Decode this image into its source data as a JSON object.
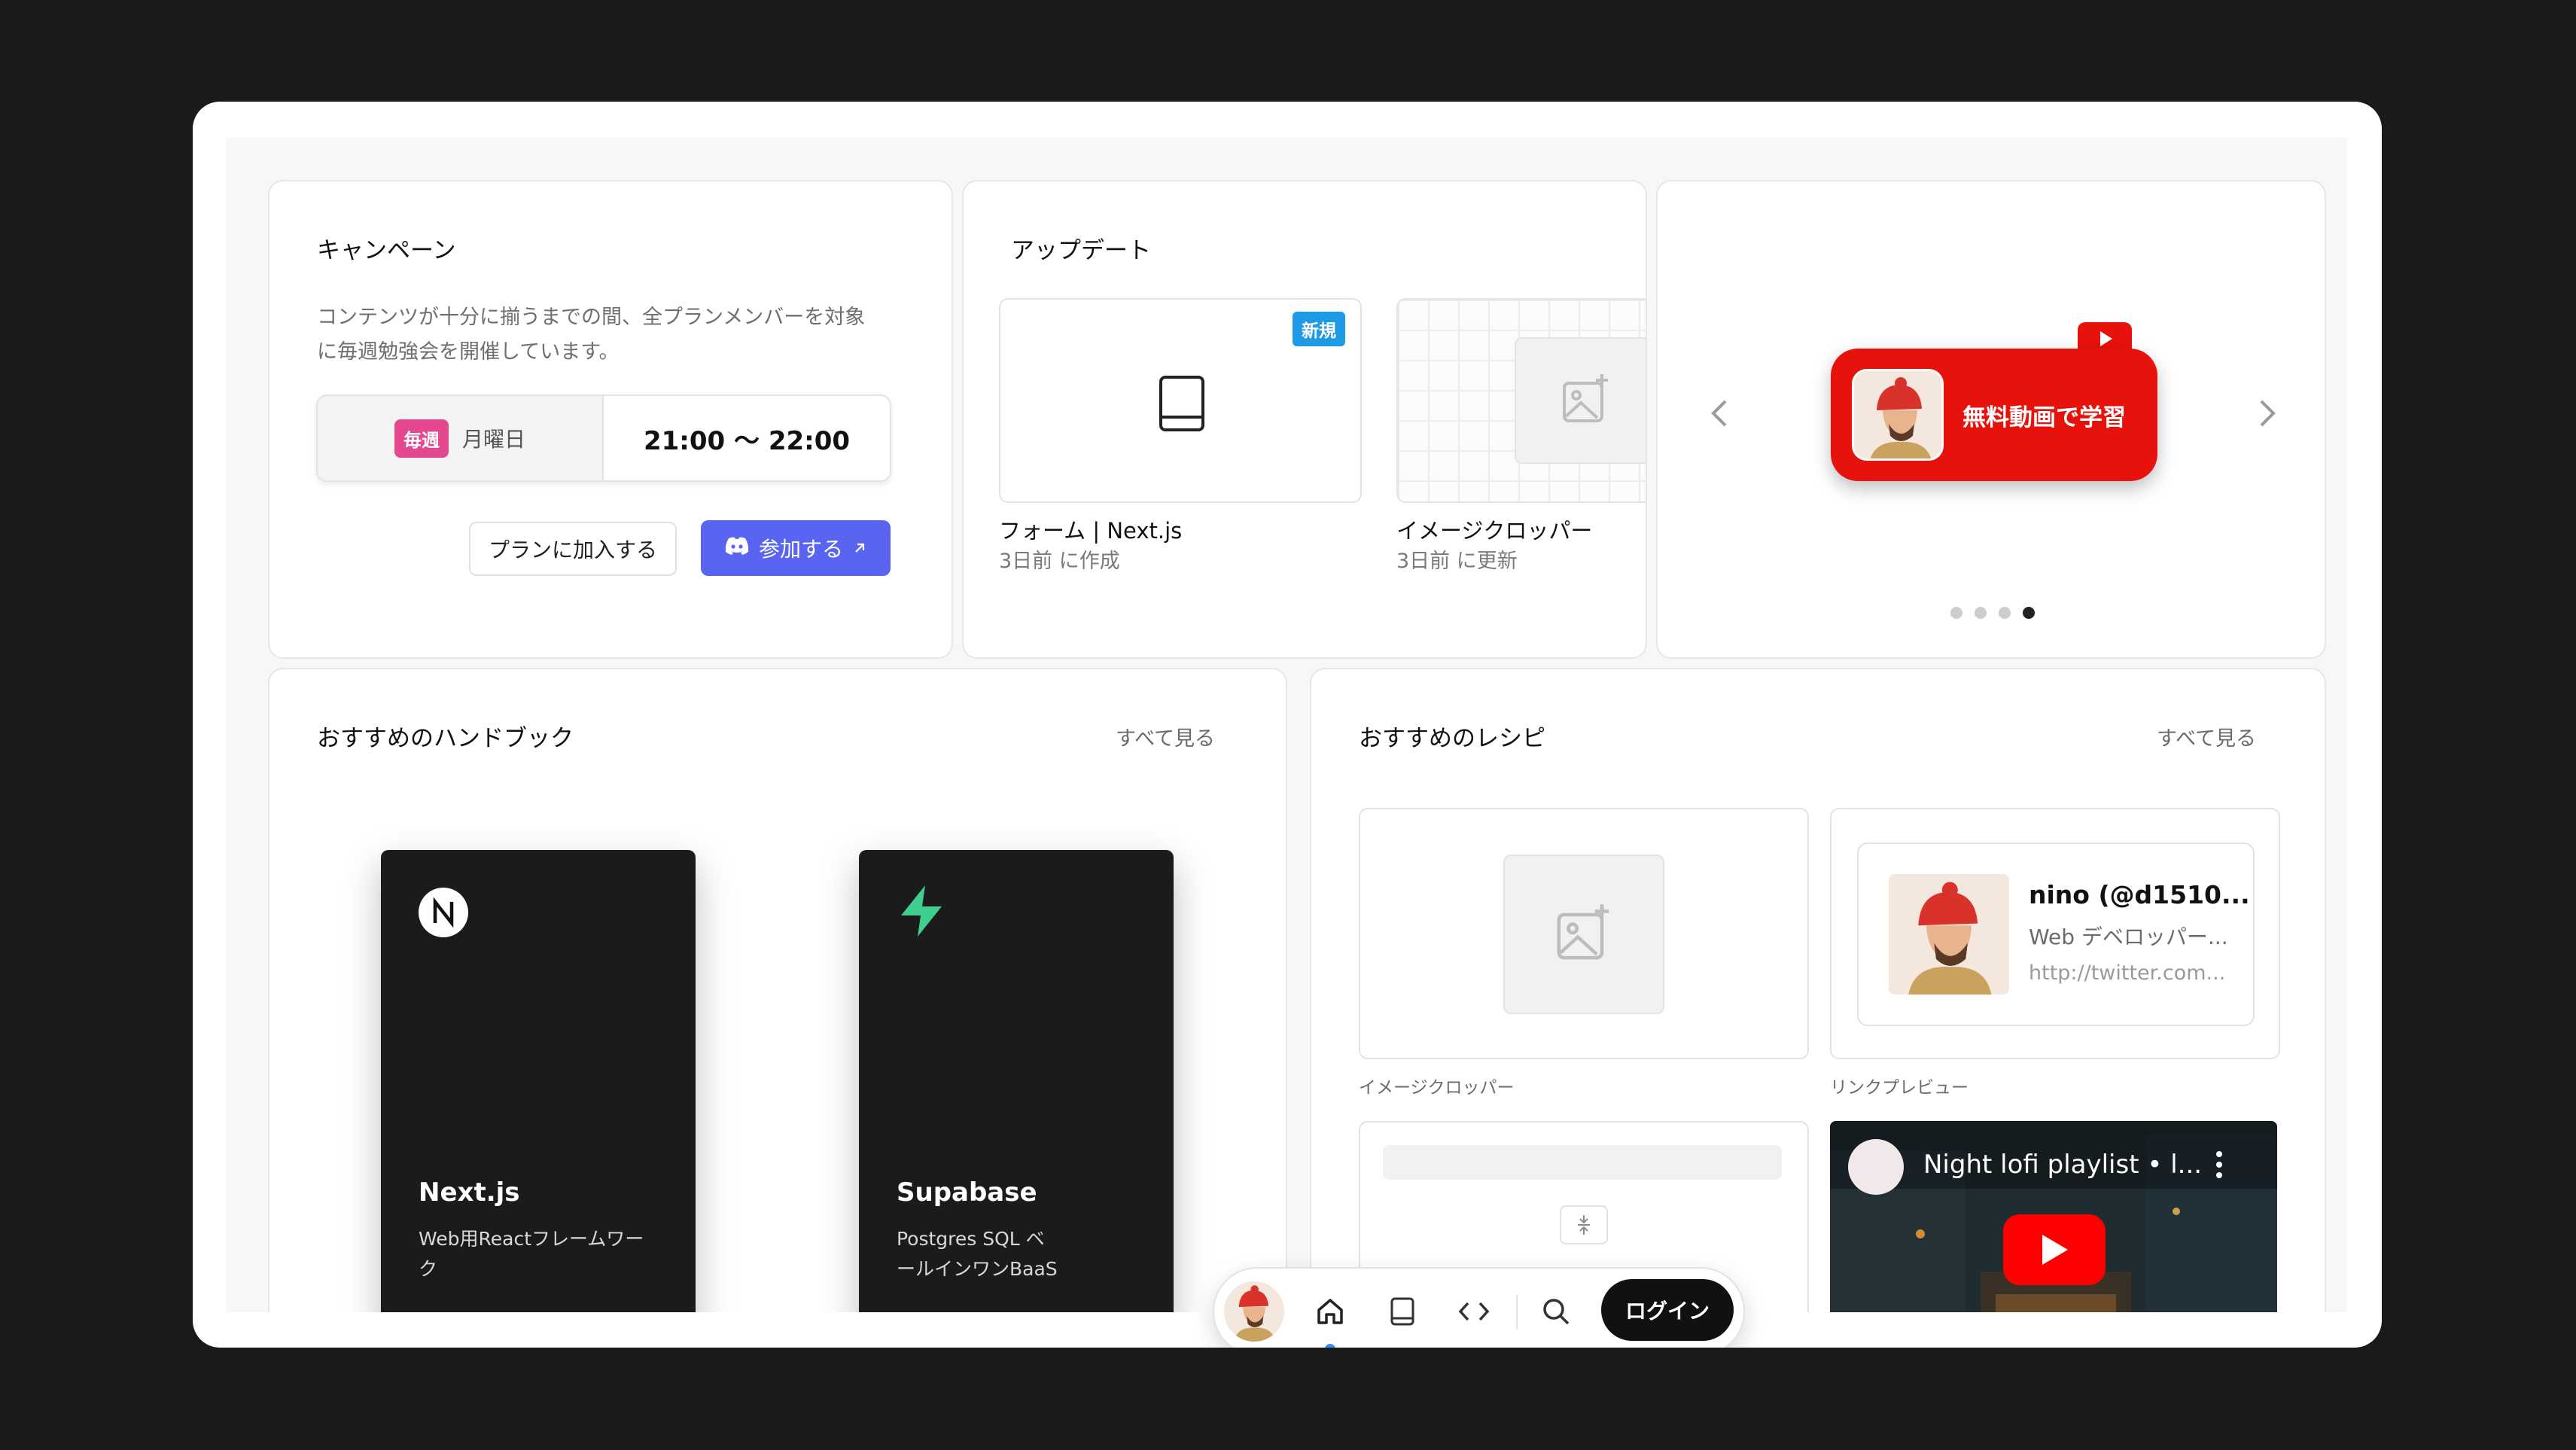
{
  "campaign": {
    "title": "キャンペーン",
    "description_line1": "コンテンツが十分に揃うまでの間、全プランメンバーを対象",
    "description_line2": "に毎週勉強会を開催しています。",
    "badge": "毎週",
    "day": "月曜日",
    "time": "21:00 〜 22:00",
    "plan_button": "プランに加入する",
    "join_button": "参加する"
  },
  "updates": {
    "title": "アップデート",
    "items": [
      {
        "name": "フォーム | Next.js",
        "meta": "3日前 に作成",
        "badge": "新規"
      },
      {
        "name": "イメージクロッパー",
        "meta": "3日前 に更新"
      }
    ]
  },
  "promo": {
    "text": "無料動画で学習",
    "slide_count": 4,
    "active_slide": 4
  },
  "handbooks": {
    "title": "おすすめのハンドブック",
    "see_all": "すべて見る",
    "books": [
      {
        "title": "Next.js",
        "desc_line1": "Web用Reactフレームワー",
        "desc_line2": "ク"
      },
      {
        "title": "Supabase",
        "desc_line1": "Postgres SQL ベ",
        "desc_line2": "ールインワンBaaS"
      }
    ]
  },
  "recipes": {
    "title": "おすすめのレシピ",
    "see_all": "すべて見る",
    "items": [
      {
        "label": "イメージクロッパー"
      },
      {
        "label": "リンクプレビュー",
        "card_name": "nino (@d1510...",
        "card_desc": "Web デベロッパー...",
        "card_url": "http://twitter.com..."
      }
    ],
    "video_title": "Night lofi playlist • l..."
  },
  "toolbar": {
    "login": "ログイン"
  }
}
